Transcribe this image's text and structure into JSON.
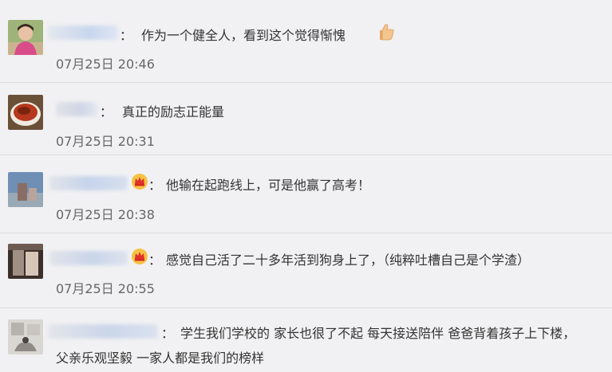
{
  "comments": [
    {
      "text": "作为一个健全人，看到这个觉得惭愧",
      "time": "07月25日 20:46",
      "has_thumbs_emoji": true,
      "has_crown": false
    },
    {
      "text": "真正的励志正能量",
      "time": "07月25日 20:31",
      "has_thumbs_emoji": false,
      "has_crown": false
    },
    {
      "text": "他输在起跑线上，可是他赢了高考！",
      "time": "07月25日 20:38",
      "has_thumbs_emoji": false,
      "has_crown": true
    },
    {
      "text": "感觉自己活了二十多年活到狗身上了，（纯粹吐槽自己是个学渣）",
      "time": "07月25日 20:55",
      "has_thumbs_emoji": false,
      "has_crown": true
    },
    {
      "text": "学生我们学校的 家长也很了不起 每天接送陪伴 爸爸背着孩子上下楼，",
      "text_line2": "父亲乐观坚毅 一家人都是我们的榜样",
      "has_thumbs_emoji": false,
      "has_crown": false
    }
  ],
  "separator": "：",
  "icons": {
    "thumbs_emoji": "thumbs-up-emoji-icon",
    "crown": "crown-icon"
  },
  "colors": {
    "background": "#f1f1f3",
    "divider": "#dcdcdf",
    "text": "#333333",
    "timestamp": "#666666"
  }
}
